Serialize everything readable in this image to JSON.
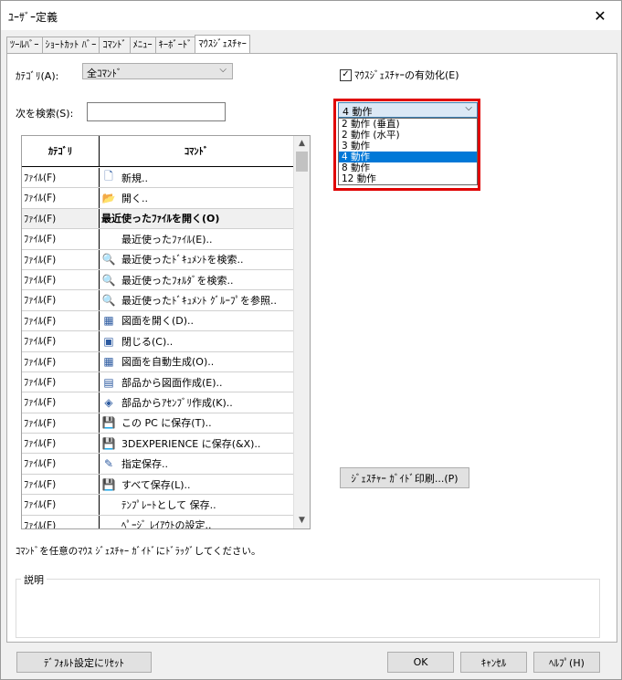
{
  "window": {
    "title": "ﾕｰｻﾞｰ定義",
    "close": "✕"
  },
  "tabs": [
    {
      "label": "ﾂｰﾙﾊﾞｰ"
    },
    {
      "label": "ｼｮｰﾄｶｯﾄ ﾊﾞｰ"
    },
    {
      "label": "ｺﾏﾝﾄﾞ"
    },
    {
      "label": "ﾒﾆｭｰ"
    },
    {
      "label": "ｷｰﾎﾞｰﾄﾞ"
    },
    {
      "label": "ﾏｳｽｼﾞｪｽﾁｬｰ",
      "active": true
    }
  ],
  "category": {
    "label": "ｶﾃｺﾞﾘ(A):",
    "value": "全ｺﾏﾝﾄﾞ"
  },
  "search": {
    "label": "次を検索(S):",
    "value": ""
  },
  "table": {
    "headers": {
      "category": "ｶﾃｺﾞﾘ",
      "command": "ｺﾏﾝﾄﾞ"
    },
    "rows": [
      {
        "category": "ﾌｧｲﾙ(F)",
        "command": "新規..",
        "icon": "new-file-icon"
      },
      {
        "category": "ﾌｧｲﾙ(F)",
        "command": "開く..",
        "icon": "open-file-icon"
      },
      {
        "category": "ﾌｧｲﾙ(F)",
        "command": "最近使ったﾌｧｲﾙを開く(O)",
        "icon": "",
        "header": true
      },
      {
        "category": "ﾌｧｲﾙ(F)",
        "command": "最近使ったﾌｧｲﾙ(E)..",
        "icon": ""
      },
      {
        "category": "ﾌｧｲﾙ(F)",
        "command": "最近使ったﾄﾞｷｭﾒﾝﾄを検索..",
        "icon": "recent-document-search-icon"
      },
      {
        "category": "ﾌｧｲﾙ(F)",
        "command": "最近使ったﾌｫﾙﾀﾞを検索..",
        "icon": "recent-folder-search-icon"
      },
      {
        "category": "ﾌｧｲﾙ(F)",
        "command": "最近使ったﾄﾞｷｭﾒﾝﾄ ｸﾞﾙｰﾌﾟを参照..",
        "icon": "document-group-icon"
      },
      {
        "category": "ﾌｧｲﾙ(F)",
        "command": "図面を開く(D)..",
        "icon": "open-drawing-icon"
      },
      {
        "category": "ﾌｧｲﾙ(F)",
        "command": "閉じる(C)..",
        "icon": "close-document-icon"
      },
      {
        "category": "ﾌｧｲﾙ(F)",
        "command": "図面を自動生成(O)..",
        "icon": "auto-drawing-icon"
      },
      {
        "category": "ﾌｧｲﾙ(F)",
        "command": "部品から図面作成(E)..",
        "icon": "part-to-drawing-icon"
      },
      {
        "category": "ﾌｧｲﾙ(F)",
        "command": "部品からｱｾﾝﾌﾞﾘ作成(K)..",
        "icon": "part-to-assembly-icon"
      },
      {
        "category": "ﾌｧｲﾙ(F)",
        "command": "この PC に保存(T)..",
        "icon": "save-icon"
      },
      {
        "category": "ﾌｧｲﾙ(F)",
        "command": "3DEXPERIENCE に保存(&X)..",
        "icon": "save-3dexperience-icon"
      },
      {
        "category": "ﾌｧｲﾙ(F)",
        "command": "指定保存..",
        "icon": "save-as-icon"
      },
      {
        "category": "ﾌｧｲﾙ(F)",
        "command": "すべて保存(L)..",
        "icon": "save-all-icon"
      },
      {
        "category": "ﾌｧｲﾙ(F)",
        "command": "ﾃﾝﾌﾟﾚｰﾄとして 保存..",
        "icon": ""
      },
      {
        "category": "ﾌｧｲﾙ(F)",
        "command": "ﾍﾟｰｼﾞ ﾚｲｱｳﾄの設定..",
        "icon": ""
      }
    ]
  },
  "enable_gestures": {
    "label": "ﾏｳｽｼﾞｪｽﾁｬｰの有効化(E)",
    "checked": true
  },
  "gesture_count": {
    "selected": "4 動作",
    "options": [
      "2 動作 (垂直)",
      "2 動作 (水平)",
      "3 動作",
      "4 動作",
      "8 動作",
      "12 動作"
    ],
    "selected_index": 3
  },
  "print_guide_button": "ｼﾞｪｽﾁｬｰ ｶﾞｲﾄﾞ印刷...(P)",
  "hint": "ｺﾏﾝﾄﾞを任意のﾏｳｽ ｼﾞｪｽﾁｬｰ ｶﾞｲﾄﾞにﾄﾞﾗｯｸﾞしてください。",
  "description": {
    "label": "説明",
    "text": ""
  },
  "buttons": {
    "reset": "ﾃﾞﾌｫﾙﾄ設定にﾘｾｯﾄ",
    "ok": "OK",
    "cancel": "ｷｬﾝｾﾙ",
    "help": "ﾍﾙﾌﾟ(H)"
  },
  "colors": {
    "selection": "#0078d7",
    "highlight_border": "#e00000"
  }
}
